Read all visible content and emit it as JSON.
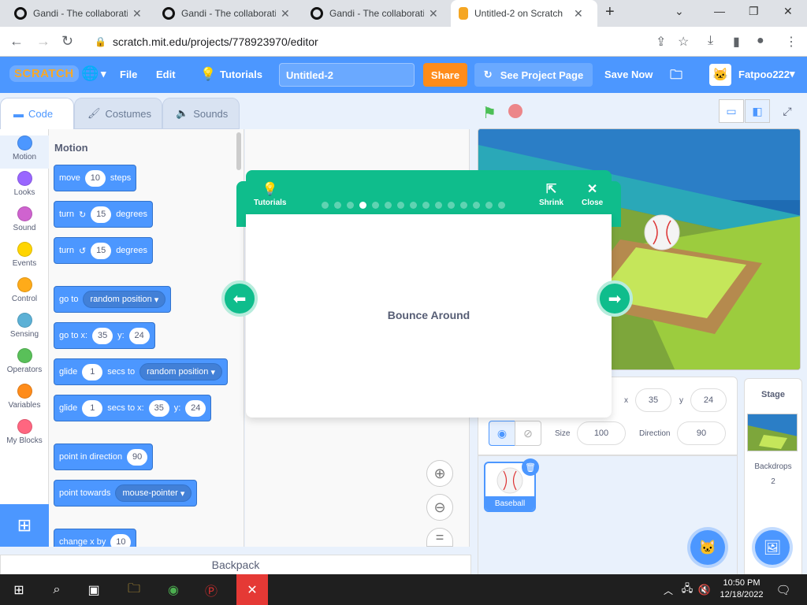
{
  "browser": {
    "tabs": [
      {
        "title": "Gandi - The collaborati...",
        "active": false
      },
      {
        "title": "Gandi - The collaborati...",
        "active": false
      },
      {
        "title": "Gandi - The collaborati...",
        "active": false
      },
      {
        "title": "Untitled-2 on Scratch",
        "active": true
      }
    ],
    "url": "scratch.mit.edu/projects/778923970/editor"
  },
  "menubar": {
    "logo": "SCRATCH",
    "file": "File",
    "edit": "Edit",
    "tutorials": "Tutorials",
    "project_title": "Untitled-2",
    "share": "Share",
    "see_project": "See Project Page",
    "save_now": "Save Now",
    "username": "Fatpoo222"
  },
  "editor_tabs": {
    "code": "Code",
    "costumes": "Costumes",
    "sounds": "Sounds"
  },
  "categories": [
    {
      "label": "Motion",
      "color": "#4c97ff"
    },
    {
      "label": "Looks",
      "color": "#9966ff"
    },
    {
      "label": "Sound",
      "color": "#cf63cf"
    },
    {
      "label": "Events",
      "color": "#ffd500"
    },
    {
      "label": "Control",
      "color": "#ffab19"
    },
    {
      "label": "Sensing",
      "color": "#5cb1d6"
    },
    {
      "label": "Operators",
      "color": "#59c059"
    },
    {
      "label": "Variables",
      "color": "#ff8c1a"
    },
    {
      "label": "My Blocks",
      "color": "#ff6680"
    }
  ],
  "palette": {
    "heading": "Motion",
    "move": {
      "a": "move",
      "n": "10",
      "b": "steps"
    },
    "turn_right": {
      "a": "turn",
      "n": "15",
      "b": "degrees"
    },
    "turn_left": {
      "a": "turn",
      "n": "15",
      "b": "degrees"
    },
    "goto": {
      "a": "go to",
      "dd": "random position"
    },
    "gotoxy": {
      "a": "go to x:",
      "x": "35",
      "yl": "y:",
      "y": "24"
    },
    "glide_to": {
      "a": "glide",
      "n": "1",
      "b": "secs to",
      "dd": "random position"
    },
    "glide_xy": {
      "a": "glide",
      "n": "1",
      "b": "secs to x:",
      "x": "35",
      "yl": "y:",
      "y": "24"
    },
    "point_dir": {
      "a": "point in direction",
      "n": "90"
    },
    "point_towards": {
      "a": "point towards",
      "dd": "mouse-pointer"
    },
    "change_x": {
      "a": "change x by",
      "n": "10"
    }
  },
  "backpack": "Backpack",
  "tutorial": {
    "tutorials_label": "Tutorials",
    "shrink_label": "Shrink",
    "close_label": "Close",
    "title": "Bounce Around",
    "steps_total": 15,
    "current_step": 4
  },
  "sprite_info": {
    "x_label": "x",
    "x": "35",
    "y_label": "y",
    "y": "24",
    "size_label": "Size",
    "size": "100",
    "direction_label": "Direction",
    "direction": "90"
  },
  "sprite": {
    "name": "Baseball"
  },
  "stage_pane": {
    "title": "Stage",
    "backdrops_label": "Backdrops",
    "backdrops_count": "2"
  },
  "taskbar": {
    "time": "10:50 PM",
    "date": "12/18/2022"
  }
}
